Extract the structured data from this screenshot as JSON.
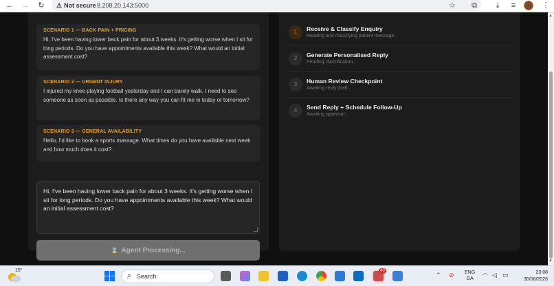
{
  "browser": {
    "security_label": "Not secure",
    "url": "8.208.20.143:5000"
  },
  "scenarios": [
    {
      "title": "SCENARIO 1 — BACK PAIN + PRICING",
      "text": "Hi, I've been having lower back pain for about 3 weeks. It's getting worse when I sit for long periods. Do you have appointments available this week? What would an initial assessment cost?"
    },
    {
      "title": "SCENARIO 2 — URGENT INJURY",
      "text": "I injured my knee playing football yesterday and I can barely walk. I need to see someone as soon as possible. Is there any way you can fit me in today or tomorrow?"
    },
    {
      "title": "SCENARIO 3 — GENERAL AVAILABILITY",
      "text": "Hello, I'd like to book a sports massage. What times do you have available next week and how much does it cost?"
    }
  ],
  "message_input": {
    "value": "Hi, I've been having lower back pain for about 3 weeks. It's getting worse when I sit for long periods. Do you have appointments available this week? What would an initial assessment cost?"
  },
  "process_button": {
    "icon": "hourglass-icon",
    "label": "Agent Processing..."
  },
  "steps": [
    {
      "number": "1",
      "title": "Receive & Classify Enquiry",
      "status": "Reading and classifying patient message..."
    },
    {
      "number": "2",
      "title": "Generate Personalised Reply",
      "status": "Pending classification..."
    },
    {
      "number": "3",
      "title": "Human Review Checkpoint",
      "status": "Awaiting reply draft..."
    },
    {
      "number": "4",
      "title": "Send Reply + Schedule Follow-Up",
      "status": "Awaiting approval..."
    }
  ],
  "taskbar": {
    "temperature": "15°",
    "search_label": "Search",
    "mail_badge": "40",
    "lang_line1": "ENG",
    "lang_line2": "GA",
    "time": "23:08",
    "date": "30/06/2026"
  },
  "colors": {
    "accent": "#e2a235",
    "background": "#101010",
    "panel": "#1c1c1c",
    "card": "#262626"
  }
}
